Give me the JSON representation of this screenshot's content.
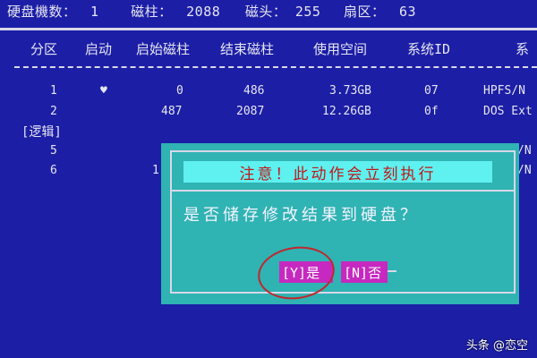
{
  "stats": {
    "disks_label": "硬盘機数：",
    "disks_value": "1",
    "cyl_label": "磁柱：",
    "cyl_value": "2088",
    "heads_label": "磁头：",
    "heads_value": "255",
    "sectors_label": "扇区：",
    "sectors_value": "63"
  },
  "table": {
    "headers": [
      "分区",
      "启动",
      "始磁柱",
      "结束磁柱",
      "使用空间",
      "系统ID",
      "系"
    ],
    "rows": [
      {
        "num": "1",
        "boot": "♥",
        "start": "0",
        "end": "486",
        "size": "3.73GB",
        "id": "07",
        "sys": "HPFS/N"
      },
      {
        "num": "2",
        "boot": "",
        "start": "487",
        "end": "2087",
        "size": "12.26GB",
        "id": "0f",
        "sys": "DOS Ext"
      }
    ],
    "logical_label": "[逻辑]",
    "logical_rows": [
      {
        "num": "5",
        "start": "",
        "tail": "/N"
      },
      {
        "num": "6",
        "start": "1",
        "tail": "/N"
      }
    ]
  },
  "dialog": {
    "title": "注意！此动作会立刻执行",
    "question": "是否储存修改结果到硬盘？",
    "yes_label": "[Y]是",
    "no_label": "[N]否"
  },
  "watermark": "头条 @恋空",
  "colors": {
    "background": "#1c1ea6",
    "dialog_bg": "#2fb3b3",
    "title_bg": "#5ff0f0",
    "title_text": "#c01818",
    "button_bg": "#c629c0",
    "annotation_circle": "#c0272d"
  }
}
